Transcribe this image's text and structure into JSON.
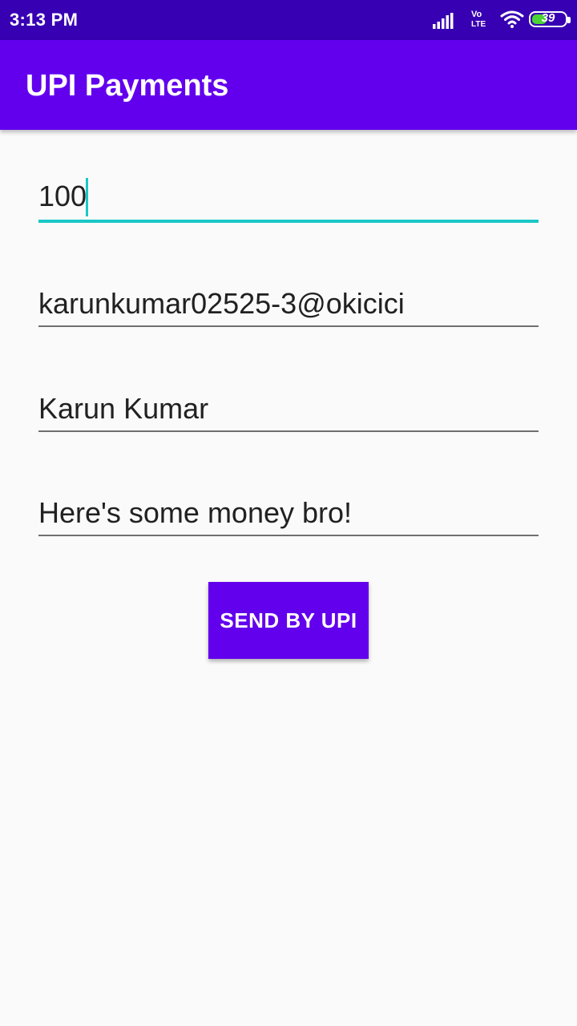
{
  "status_bar": {
    "time": "3:13 PM",
    "network_top": "Vo",
    "network_bottom": "LTE",
    "battery_level": "39",
    "icons": [
      "signal-icon",
      "volte-icon",
      "wifi-icon",
      "battery-icon"
    ]
  },
  "app_bar": {
    "title": "UPI Payments",
    "color": "#6200ee"
  },
  "form": {
    "amount": "100",
    "upi_id": "karunkumar02525-3@okicici",
    "name": "Karun Kumar",
    "note": "Here's some money bro!",
    "focused_field": "amount",
    "accent_color": "#1ac7c7"
  },
  "send_button": {
    "label": "SEND BY UPI",
    "color": "#6200ee"
  }
}
